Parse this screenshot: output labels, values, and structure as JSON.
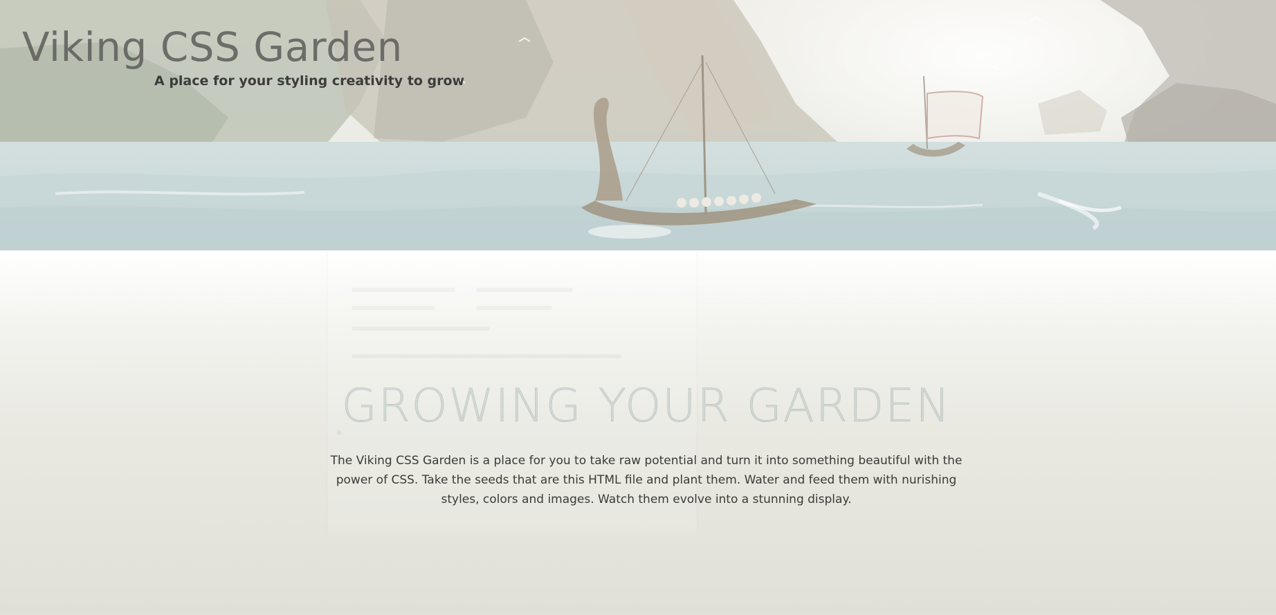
{
  "header": {
    "title": "Viking CSS Garden",
    "tagline": "A place for your styling creativity to grow"
  },
  "hero_image": {
    "icon": "viking-longship-landscape-banner"
  },
  "intro": {
    "heading": "GROWING YOUR GARDEN",
    "paragraph": "The Viking CSS Garden is a place for you to take raw potential and turn it into something beautiful with the power of CSS. Take the seeds that are this HTML file and plant them. Water and feed them with nurishing styles, colors and images. Watch them evolve into a stunning display."
  },
  "colors": {
    "title": "#5d5d5a",
    "heading": "#a0b2b0",
    "body_text": "#3a3a38",
    "background_bottom": "#e0e0d8"
  }
}
